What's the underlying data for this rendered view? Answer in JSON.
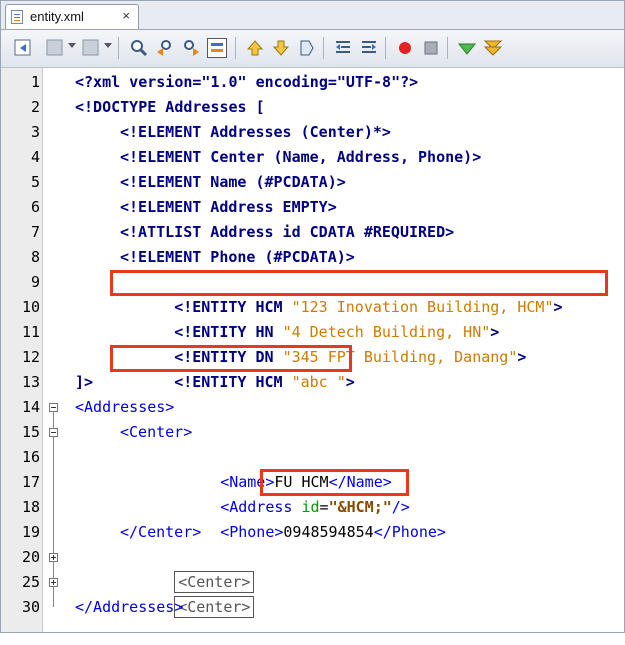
{
  "tab": {
    "filename": "entity.xml",
    "close": "×"
  },
  "toolbar": {
    "buttons": [
      "back-icon",
      "forward-icon",
      "history-icon",
      "find-icon",
      "find-previous-icon",
      "find-next-icon",
      "toggle-highlight-icon",
      "previous-bookmark-icon",
      "next-bookmark-icon",
      "toggle-bookmark-icon",
      "shift-left-icon",
      "shift-right-icon",
      "record-macro-icon",
      "stop-macro-icon",
      "check-xml-icon",
      "validate-xml-icon"
    ]
  },
  "editor": {
    "line_numbers": [
      "1",
      "2",
      "3",
      "4",
      "5",
      "6",
      "7",
      "8",
      "9",
      "10",
      "11",
      "12",
      "13",
      "14",
      "15",
      "16",
      "17",
      "18",
      "19",
      "20",
      "25",
      "30"
    ],
    "lines": {
      "l1": "<?xml version=\"1.0\" encoding=\"UTF-8\"?>",
      "l2": "<!DOCTYPE Addresses [",
      "l3": "<!ELEMENT Addresses (Center)*>",
      "l4": "<!ELEMENT Center (Name, Address, Phone)>",
      "l5": "<!ELEMENT Name (#PCDATA)>",
      "l6": "<!ELEMENT Address EMPTY>",
      "l7": "<!ATTLIST Address id CDATA #REQUIRED>",
      "l8": "<!ELEMENT Phone (#PCDATA)>",
      "l9_decl": "<!ENTITY HCM ",
      "l9_str": "\"123 Inovation Building, HCM\"",
      "l9_end": ">",
      "l10_decl": "<!ENTITY HN ",
      "l10_str": "\"4 Detech Building, HN\"",
      "l10_end": ">",
      "l11_decl": "<!ENTITY DN ",
      "l11_str": "\"345 FPT Building, Danang\"",
      "l11_end": ">",
      "l12_decl": "<!ENTITY HCM ",
      "l12_str": "\"abc \"",
      "l12_end": ">",
      "l13": "]>",
      "l14": "<Addresses>",
      "l15": "<Center>",
      "l16_open": "<Name>",
      "l16_text": "FU HCM",
      "l16_close": "</Name>",
      "l17_open": "<Address ",
      "l17_attr": "id",
      "l17_eq": "=",
      "l17_val": "\"&HCM;\"",
      "l17_close": "/>",
      "l18_open": "<Phone>",
      "l18_text": "0948594854",
      "l18_close": "</Phone>",
      "l19": "</Center>",
      "l20": "<Center>",
      "l25": "<Center>",
      "l30": "</Addresses>"
    }
  }
}
